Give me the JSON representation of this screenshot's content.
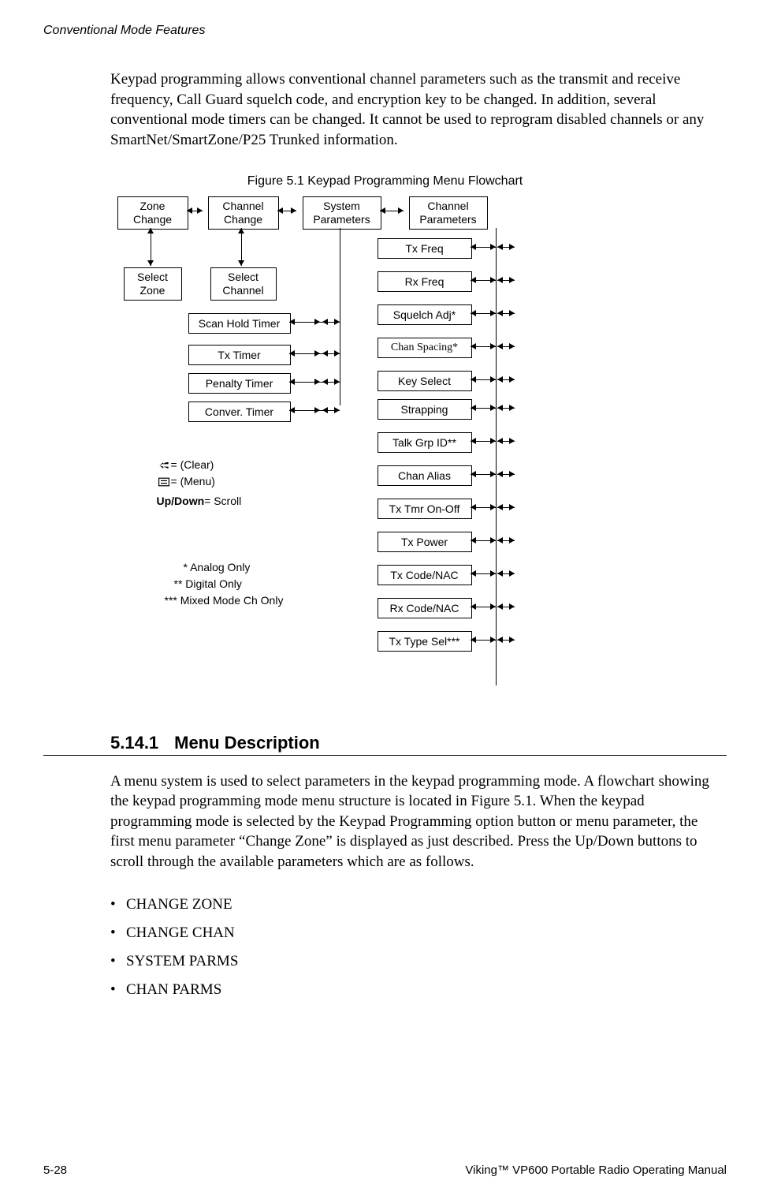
{
  "header": "Conventional Mode Features",
  "intro": "Keypad programming allows conventional channel parameters such as the transmit and receive frequency, Call Guard squelch code, and encryption key to be changed. In addition, several conventional mode timers can be changed. It cannot be used to reprogram disabled channels or any SmartNet/SmartZone/P25 Trunked information.",
  "figure_caption": "Figure 5.1  Keypad Programming Menu Flowchart",
  "chart_data": {
    "type": "flowchart",
    "top_row": [
      {
        "id": "zone-change",
        "label": "Zone\nChange"
      },
      {
        "id": "channel-change",
        "label": "Channel\nChange"
      },
      {
        "id": "system-parameters",
        "label": "System\nParameters"
      },
      {
        "id": "channel-parameters",
        "label": "Channel\nParameters"
      }
    ],
    "select_row": [
      {
        "id": "select-zone",
        "label": "Select\nZone"
      },
      {
        "id": "select-channel",
        "label": "Select\nChannel"
      }
    ],
    "system_items": [
      "Scan Hold Timer",
      "Tx Timer",
      "Penalty Timer",
      "Conver. Timer"
    ],
    "channel_items": [
      "Tx Freq",
      "Rx Freq",
      "Squelch Adj*",
      "Chan Spacing*",
      "Key Select",
      "Strapping",
      "Talk Grp ID**",
      "Chan Alias",
      "Tx Tmr On-Off",
      "Tx Power",
      "Tx Code/NAC",
      "Rx Code/NAC",
      "Tx Type Sel***"
    ],
    "legend": {
      "clear": " = (Clear)",
      "menu": " = (Menu)",
      "scroll_label": "Up/Down",
      "scroll_text": " = Scroll",
      "note1": "* Analog Only",
      "note2": "** Digital Only",
      "note3": "*** Mixed Mode Ch Only"
    }
  },
  "section": {
    "number": "5.14.1",
    "title": "Menu Description"
  },
  "section_body": "A menu system is used to select parameters in the keypad programming mode. A flowchart showing the keypad programming mode menu structure is located in Figure 5.1. When the keypad programming mode is selected by the Keypad Programming option button or menu parameter, the first menu parameter “Change Zone” is displayed as just described. Press the Up/Down buttons to scroll through the available parameters which are as follows.",
  "list_items": [
    "CHANGE ZONE",
    "CHANGE CHAN",
    "SYSTEM PARMS",
    "CHAN PARMS"
  ],
  "footer": {
    "left": "5-28",
    "right": "Viking™ VP600 Portable Radio Operating Manual"
  }
}
